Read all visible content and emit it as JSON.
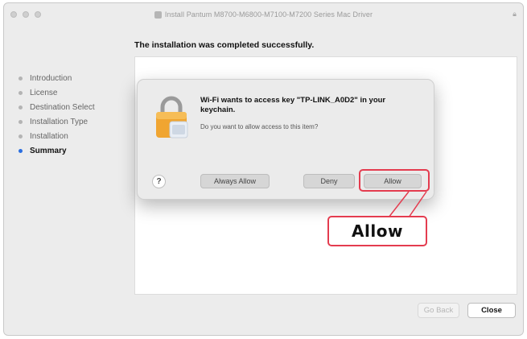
{
  "window": {
    "title": "Install Pantum M8700-M6800-M7100-M7200 Series Mac Driver"
  },
  "installer": {
    "heading": "The installation was completed successfully.",
    "steps": [
      {
        "label": "Introduction",
        "active": false
      },
      {
        "label": "License",
        "active": false
      },
      {
        "label": "Destination Select",
        "active": false
      },
      {
        "label": "Installation Type",
        "active": false
      },
      {
        "label": "Installation",
        "active": false
      },
      {
        "label": "Summary",
        "active": true
      }
    ],
    "go_back_label": "Go Back",
    "close_label": "Close"
  },
  "dialog": {
    "title": "Wi-Fi wants to access key \"TP-LINK_A0D2\" in your keychain.",
    "subtitle": "Do you want to allow access to this item?",
    "help_label": "?",
    "always_allow_label": "Always Allow",
    "deny_label": "Deny",
    "allow_label": "Allow"
  },
  "annotation": {
    "callout_label": "Allow",
    "highlight_color": "#e43c4f"
  }
}
